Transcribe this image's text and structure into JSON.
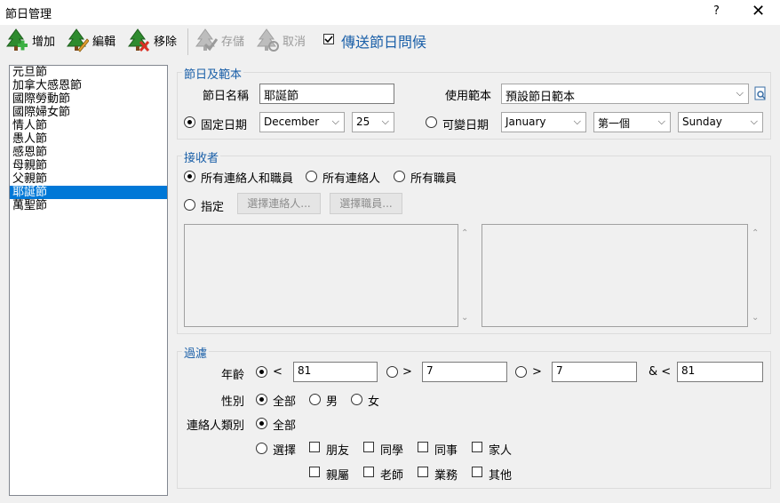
{
  "window": {
    "title": "節日管理",
    "help": "?",
    "close": "✕"
  },
  "toolbar": {
    "add": "增加",
    "edit": "編輯",
    "remove": "移除",
    "save": "存儲",
    "cancel": "取消",
    "send_greeting": "傳送節日問候",
    "send_greeting_checked": true
  },
  "holidays": {
    "items": [
      "元旦節",
      "加拿大感恩節",
      "國際勞動節",
      "國際婦女節",
      "情人節",
      "愚人節",
      "感恩節",
      "母親節",
      "父親節",
      "耶誕節",
      "萬聖節"
    ],
    "selected_index": 9
  },
  "holiday_section": {
    "label": "節日及範本",
    "name_label": "節日名稱",
    "name_value": "耶誕節",
    "template_label": "使用範本",
    "template_value": "預設節日範本",
    "fixed_date_label": "固定日期",
    "fixed_date_selected": true,
    "month_value": "December",
    "day_value": "25",
    "variable_date_label": "可變日期",
    "var_month_value": "January",
    "var_week_value": "第一個",
    "var_day_value": "Sunday"
  },
  "recipients": {
    "label": "接收者",
    "all_contacts_staff": "所有連絡人和職員",
    "all_contacts": "所有連絡人",
    "all_staff": "所有職員",
    "specify": "指定",
    "choose_contacts": "選擇連絡人...",
    "choose_staff": "選擇職員..."
  },
  "filter": {
    "label": "過濾",
    "age_label": "年齡",
    "age_lt_op": "<",
    "age_lt_value": "81",
    "age_gt_op": ">",
    "age_gt_value": "7",
    "age_range_op1": ">",
    "age_range_value1": "7",
    "age_range_op2": "& <",
    "age_range_value2": "81",
    "gender_label": "性別",
    "gender_all": "全部",
    "gender_male": "男",
    "gender_female": "女",
    "contact_type_label": "連絡人類別",
    "type_all": "全部",
    "type_select": "選擇",
    "types": [
      "朋友",
      "同學",
      "同事",
      "家人",
      "親屬",
      "老師",
      "業務",
      "其他"
    ]
  }
}
